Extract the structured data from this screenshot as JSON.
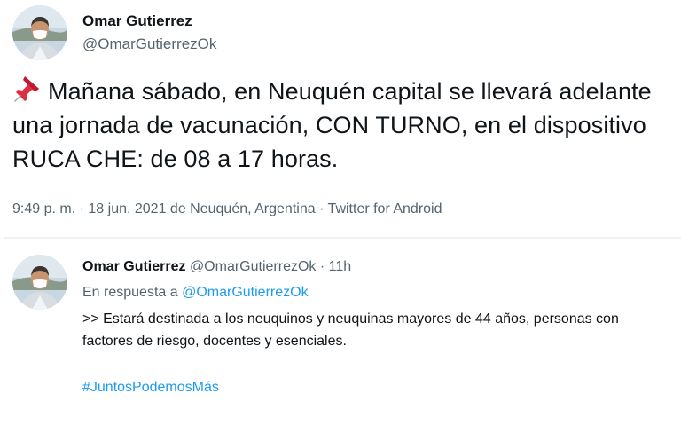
{
  "main_tweet": {
    "author_name": "Omar Gutierrez",
    "author_handle": "@OmarGutierrezOk",
    "avatar_icon": "profile-photo",
    "pin_icon": "pushpin-emoji",
    "text": "Mañana sábado, en Neuquén capital se llevará adelante una jornada de vacunación, CON TURNO, en el dispositivo RUCA CHE: de 08 a 17 horas.",
    "time": "9:49 p. m.",
    "separator": "·",
    "date": "18 jun. 2021",
    "location": "de Neuquén, Argentina",
    "source": "Twitter for Android"
  },
  "reply_tweet": {
    "author_name": "Omar Gutierrez",
    "author_handle": "@OmarGutierrezOk",
    "separator": "·",
    "time": "11h",
    "in_reply_to_label": "En respuesta a",
    "in_reply_to_handle": "@OmarGutierrezOk",
    "text": ">> Estará destinada a los neuquinos y neuquinas mayores de 44 años, personas con factores de riesgo, docentes y esenciales.",
    "hashtag": "#JuntosPodemosMás"
  },
  "colors": {
    "text_primary": "#0f1419",
    "text_secondary": "#536471",
    "link": "#1d9bf0",
    "divider": "#eff3f4"
  }
}
